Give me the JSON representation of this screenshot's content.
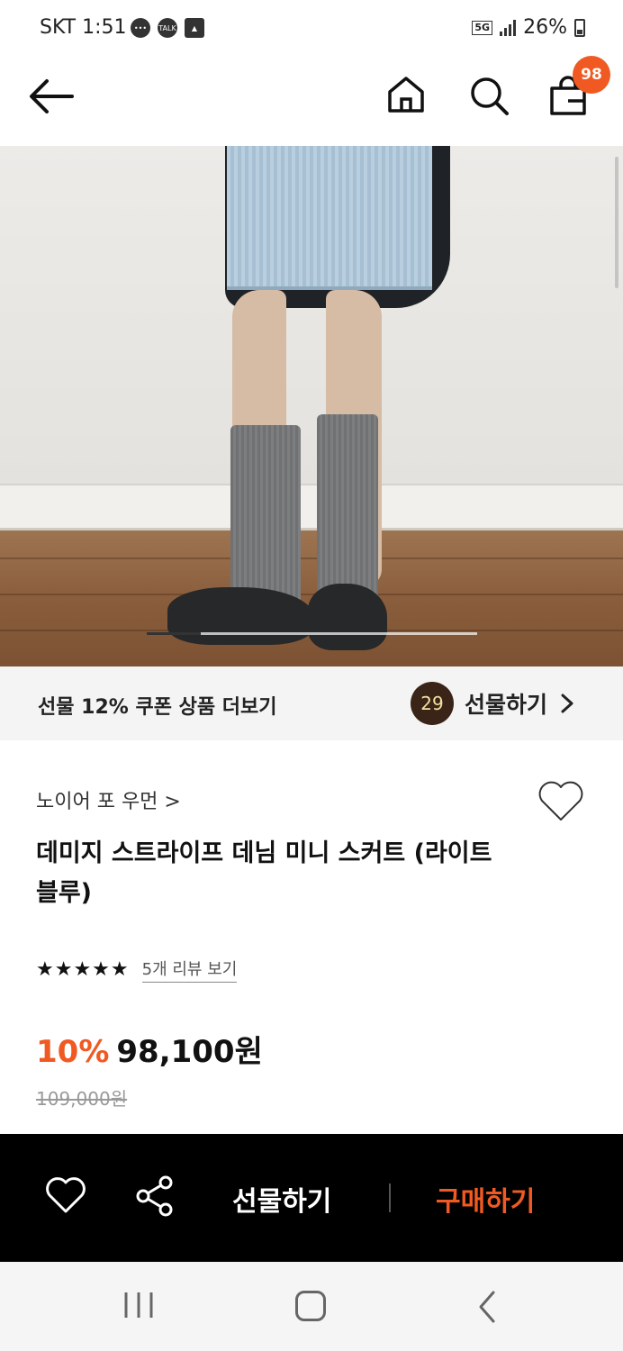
{
  "status_bar": {
    "carrier_time": "SKT 1:51",
    "network": "5G",
    "battery": "26%"
  },
  "nav": {
    "cart_count": "98"
  },
  "hero": {
    "image_description": "product photo: model wearing light-blue denim mini skirt with grey knee socks and black loafers",
    "slide_index": 1
  },
  "coupon": {
    "text": "선물 12% 쿠폰 상품 더보기",
    "gift_badge": "29",
    "gift_label": "선물하기"
  },
  "product": {
    "brand": "노이어 포 우먼 >",
    "title": "데미지 스트라이프 데님 미니 스커트 (라이트블루)",
    "rating_stars": 5,
    "reviews": "5개 리뷰 보기",
    "discount": "10%",
    "sale_price": "98,100원",
    "original_price": "109,000원"
  },
  "actions": {
    "gift": "선물하기",
    "buy": "구매하기"
  },
  "colors": {
    "accent": "#f05a22",
    "action_bar": "#000000",
    "coupon_bg": "#f4f4f4",
    "gift_circle": "#3a2418"
  }
}
